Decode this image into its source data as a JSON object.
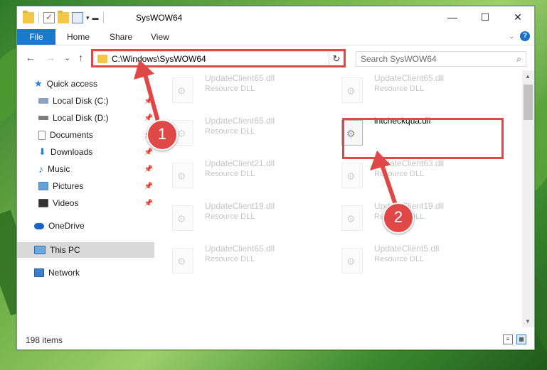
{
  "window": {
    "title": "SysWOW64",
    "controls": {
      "minimize": "—",
      "maximize": "☐",
      "close": "✕"
    }
  },
  "ribbon": {
    "tabs": [
      "File",
      "Home",
      "Share",
      "View"
    ],
    "help": "?"
  },
  "nav": {
    "back": "←",
    "forward": "→",
    "recent": "⌄",
    "up": "↑",
    "address": "C:\\Windows\\SysWOW64",
    "refresh": "↻",
    "search_placeholder": "Search SysWOW64"
  },
  "sidebar": {
    "items": [
      {
        "label": "Quick access",
        "icon": "star-icon",
        "pinned": false
      },
      {
        "label": "Local Disk (C:)",
        "icon": "drive-icon",
        "pinned": true
      },
      {
        "label": "Local Disk (D:)",
        "icon": "drive-icon",
        "pinned": true
      },
      {
        "label": "Documents",
        "icon": "documents-icon",
        "pinned": true
      },
      {
        "label": "Downloads",
        "icon": "downloads-icon",
        "pinned": true
      },
      {
        "label": "Music",
        "icon": "music-icon",
        "pinned": true
      },
      {
        "label": "Pictures",
        "icon": "pictures-icon",
        "pinned": true
      },
      {
        "label": "Videos",
        "icon": "videos-icon",
        "pinned": true
      },
      {
        "label": "OneDrive",
        "icon": "cloud-icon",
        "pinned": false
      },
      {
        "label": "This PC",
        "icon": "computer-icon",
        "pinned": false
      },
      {
        "label": "Network",
        "icon": "network-icon",
        "pinned": false
      }
    ]
  },
  "files": [
    {
      "name": "UpdateClient65.dll",
      "type": "Resource DLL",
      "faded": true
    },
    {
      "name": "UpdateClient65.dll",
      "type": "Resource DLL",
      "faded": true
    },
    {
      "name": "UpdateClient65.dll",
      "type": "Resource DLL",
      "faded": true
    },
    {
      "name": "intcheckqua.dll",
      "type": "",
      "faded": false
    },
    {
      "name": "UpdateClient21.dll",
      "type": "Resource DLL",
      "faded": true
    },
    {
      "name": "UpdateClient63.dll",
      "type": "Resource DLL",
      "faded": true
    },
    {
      "name": "UpdateClient19.dll",
      "type": "Resource DLL",
      "faded": true
    },
    {
      "name": "UpdateClient19.dll",
      "type": "Resource DLL",
      "faded": true
    },
    {
      "name": "UpdateClient65.dll",
      "type": "Resource DLL",
      "faded": true
    },
    {
      "name": "UpdateClient5.dll",
      "type": "Resource DLL",
      "faded": true
    }
  ],
  "status": {
    "items": "198 items"
  },
  "annotations": {
    "badge1": "1",
    "badge2": "2"
  },
  "colors": {
    "accent": "#1979ca",
    "highlight": "#e04848"
  }
}
